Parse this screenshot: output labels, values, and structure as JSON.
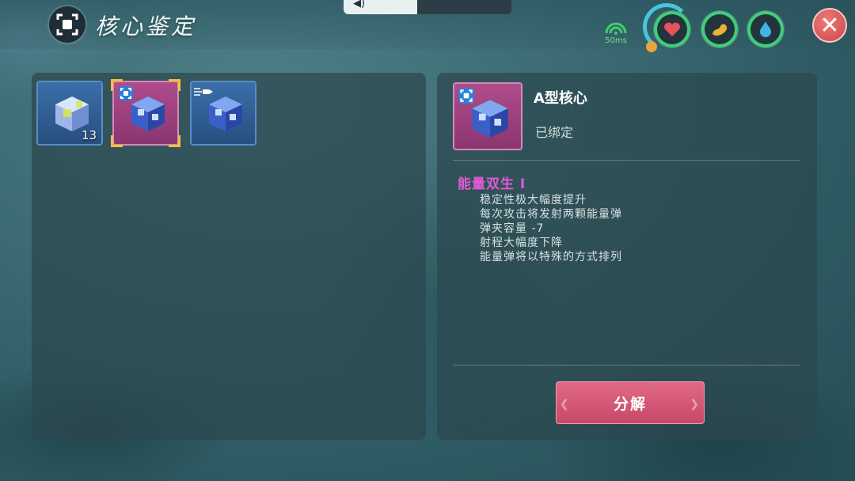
{
  "header": {
    "title": "核心鉴定",
    "title_icon": "core-appraisal-icon",
    "volume_level": 0.44,
    "ping": "50ms",
    "stats": [
      {
        "name": "health",
        "icon": "heart-icon",
        "color": "#e8505b"
      },
      {
        "name": "stamina",
        "icon": "muscle-icon",
        "color": "#e8b23a"
      },
      {
        "name": "hydration",
        "icon": "water-drop-icon",
        "color": "#3fb4e8"
      }
    ],
    "close_icon": "close-icon"
  },
  "inventory": {
    "slots": [
      {
        "rarity": "blue",
        "quantity": "13",
        "selected": false,
        "mark": "none"
      },
      {
        "rarity": "pink",
        "quantity": "",
        "selected": true,
        "mark": "bound"
      },
      {
        "rarity": "blue",
        "quantity": "",
        "selected": false,
        "mark": "bullet"
      }
    ]
  },
  "detail": {
    "name": "A型核心",
    "status": "已绑定",
    "effect_title": "能量双生 I",
    "effects": [
      "稳定性极大幅度提升",
      "每次攻击将发射两颗能量弹",
      "弹夹容量 -7",
      "射程大幅度下降",
      "能量弹将以特殊的方式排列"
    ],
    "dismantle_label": "分解"
  },
  "colors": {
    "accent_pink": "#e05ad8",
    "button": "#d45873",
    "select_frame": "#f2c23a"
  }
}
